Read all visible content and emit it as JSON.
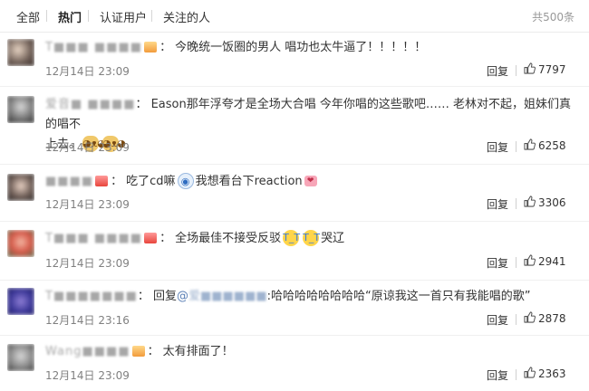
{
  "tabs": {
    "all": "全部",
    "hot": "热门",
    "verified": "认证用户",
    "following": "关注的人"
  },
  "total": "共500条",
  "reply_label": "回复",
  "comments": [
    {
      "username": "T■■■ ■■■■",
      "text": "今晚统一饭圈的男人 唱功也太牛逼了！！！！！",
      "time": "12月14日 23:09",
      "likes": "7797"
    },
    {
      "username": "爱音■ ■■■■",
      "line1": "Eason那年浮夸才是全场大合唱 今年你唱的这些歌吧…… 老林对不起，姐妹们真的唱不",
      "line2": "上去。",
      "time": "12月14日 23:09",
      "likes": "6258"
    },
    {
      "username": "■■■■",
      "text_a": "吃了cd嘛",
      "text_b": "我想看台下reaction",
      "time": "12月14日 23:09",
      "likes": "3306"
    },
    {
      "username": "T■■■ ■■■■",
      "text_a": "全场最佳不接受反驳",
      "text_b": "哭辽",
      "time": "12月14日 23:09",
      "likes": "2941"
    },
    {
      "username": "T■■■■■■■",
      "reply_prefix": "回复",
      "mention_at": "@",
      "mention_name": "爱■■■■■■",
      "text": ":哈哈哈哈哈哈哈哈“原谅我这一首只有我能唱的歌”",
      "time": "12月14日 23:16",
      "likes": "2878"
    },
    {
      "username": "Wang■■■■",
      "text": "太有排面了！",
      "time": "12月14日 23:09",
      "likes": "2363"
    }
  ],
  "colors": {
    "link": "#5a7fb5",
    "muted": "#808080",
    "divider": "#f0f0f0"
  },
  "icons": [
    "thumbs-up-icon",
    "crying-face-emoji",
    "dog-face-emoji",
    "stare-emoji",
    "kiss-emoji"
  ]
}
